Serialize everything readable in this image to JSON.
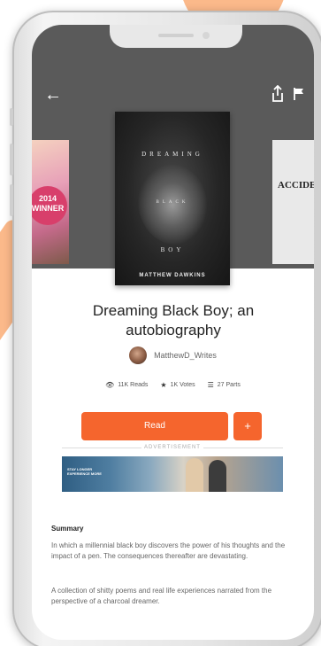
{
  "app": {
    "accent_color": "#f5652d",
    "header_bg": "#5a5a5a"
  },
  "header": {
    "back_icon": "arrow-left-icon",
    "share_icon": "share-icon",
    "flag_icon": "flag-icon"
  },
  "covers": {
    "left_badge": "2014 WINNER",
    "right_title": "ACCIDE",
    "main": {
      "line1": "DREAMING",
      "line2": "BLACK",
      "line3": "BOY",
      "author": "MATTHEW DAWKINS"
    }
  },
  "story": {
    "title": "Dreaming Black Boy; an autobiography",
    "author": "MatthewD_Writes",
    "stats": {
      "reads": "11K Reads",
      "votes": "1K Votes",
      "parts": "27 Parts"
    },
    "read_label": "Read",
    "add_label": "+",
    "ad_label": "ADVERTISEMENT",
    "summary_heading": "Summary",
    "summary_p1": "In which a millennial black boy discovers the power of his thoughts and the impact of a pen. The consequences thereafter are devastating.",
    "summary_p2": "A collection of shitty poems and real life experiences narrated from the perspective of a charcoal dreamer."
  }
}
